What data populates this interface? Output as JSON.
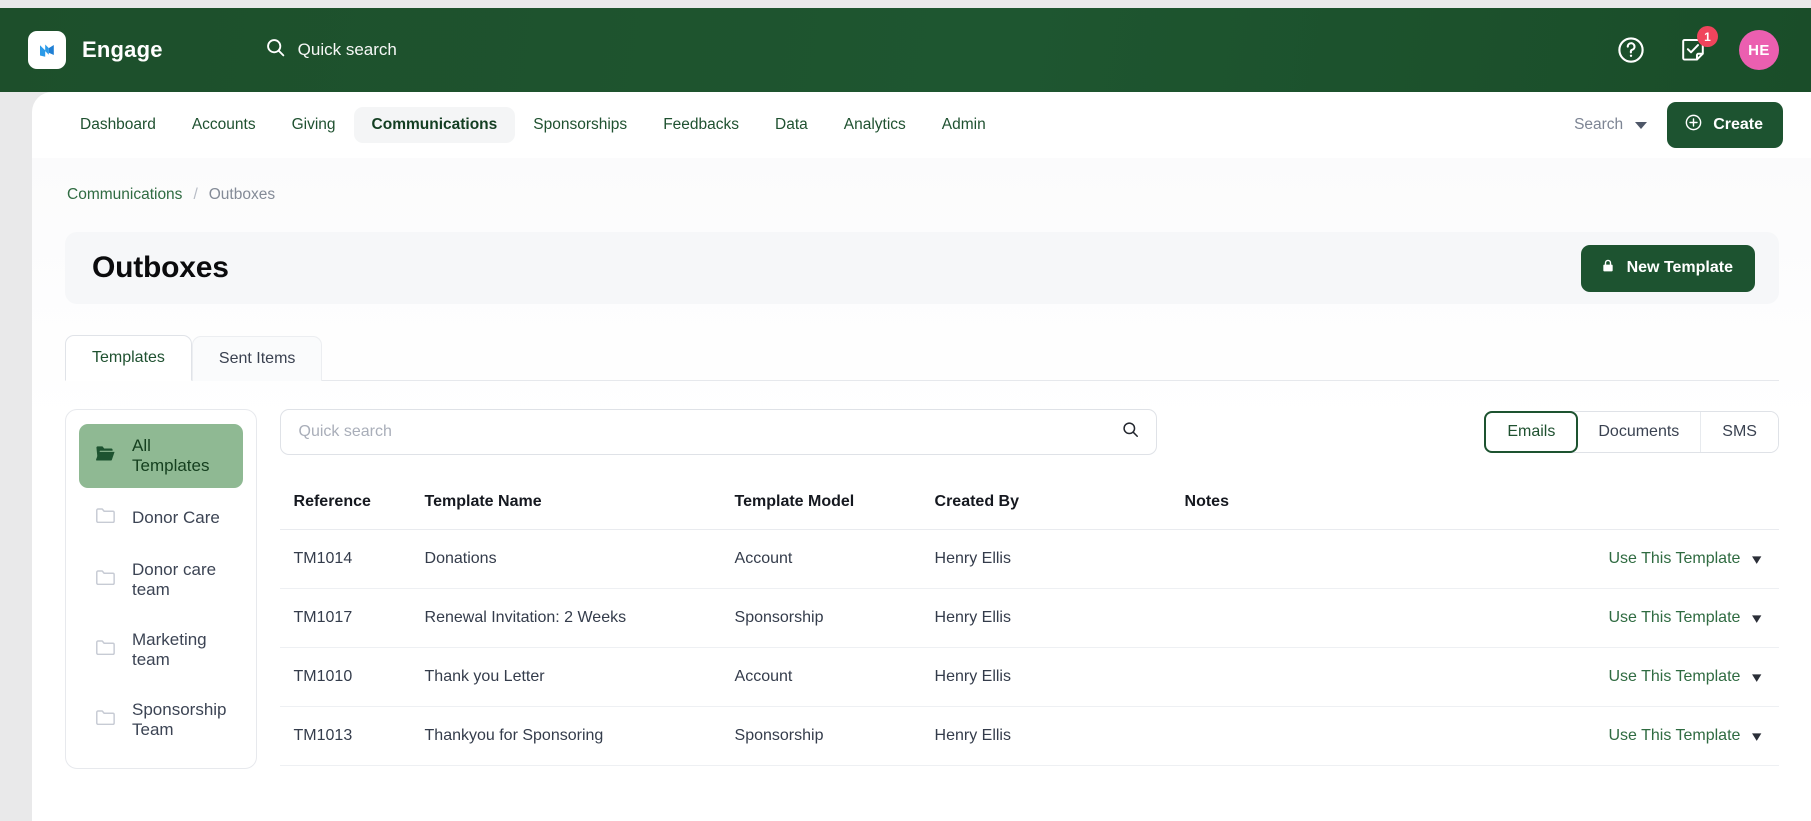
{
  "header": {
    "brand": "Engage",
    "logo_icon": "engage-logo-icon",
    "quick_search_placeholder": "Quick search",
    "search_icon": "search-icon",
    "help_icon": "help-circle-icon",
    "tasks_icon": "task-note-icon",
    "tasks_badge": "1",
    "avatar_initials": "HE",
    "colors": {
      "bar": "#1e5630",
      "badge": "#f0445c",
      "avatar": "#eb5fb0"
    }
  },
  "nav": {
    "items": [
      {
        "label": "Dashboard",
        "active": false
      },
      {
        "label": "Accounts",
        "active": false
      },
      {
        "label": "Giving",
        "active": false
      },
      {
        "label": "Communications",
        "active": true
      },
      {
        "label": "Sponsorships",
        "active": false
      },
      {
        "label": "Feedbacks",
        "active": false
      },
      {
        "label": "Data",
        "active": false
      },
      {
        "label": "Analytics",
        "active": false
      },
      {
        "label": "Admin",
        "active": false
      }
    ],
    "search_label": "Search",
    "create_label": "Create",
    "create_icon": "plus-circle-icon",
    "dropdown_icon": "chevron-down-icon"
  },
  "breadcrumb": {
    "parent": "Communications",
    "separator": "/",
    "current": "Outboxes"
  },
  "page": {
    "title": "Outboxes",
    "new_template_label": "New Template",
    "new_template_icon": "lock-icon"
  },
  "tabs": [
    {
      "label": "Templates",
      "active": true
    },
    {
      "label": "Sent Items",
      "active": false
    }
  ],
  "folders": {
    "items": [
      {
        "label": "All Templates",
        "active": true,
        "icon": "folder-open-icon"
      },
      {
        "label": "Donor Care",
        "active": false,
        "icon": "folder-icon"
      },
      {
        "label": "Donor care team",
        "active": false,
        "icon": "folder-icon"
      },
      {
        "label": "Marketing team",
        "active": false,
        "icon": "folder-icon"
      },
      {
        "label": "Sponsorship Team",
        "active": false,
        "icon": "folder-icon"
      }
    ],
    "active_color": "#8fb993"
  },
  "toolbar": {
    "search_placeholder": "Quick search",
    "search_value": "",
    "search_icon": "search-icon",
    "segments": [
      {
        "label": "Emails",
        "active": true
      },
      {
        "label": "Documents",
        "active": false
      },
      {
        "label": "SMS",
        "active": false
      }
    ]
  },
  "table": {
    "columns": [
      "Reference",
      "Template Name",
      "Template Model",
      "Created By",
      "Notes",
      ""
    ],
    "action_label": "Use This Template",
    "action_icon": "chevron-down-icon",
    "rows": [
      {
        "reference": "TM1014",
        "name": "Donations",
        "model": "Account",
        "created_by": "Henry Ellis",
        "notes": ""
      },
      {
        "reference": "TM1017",
        "name": "Renewal Invitation: 2 Weeks",
        "model": "Sponsorship",
        "created_by": "Henry Ellis",
        "notes": ""
      },
      {
        "reference": "TM1010",
        "name": "Thank you Letter",
        "model": "Account",
        "created_by": "Henry Ellis",
        "notes": ""
      },
      {
        "reference": "TM1013",
        "name": "Thankyou for Sponsoring",
        "model": "Sponsorship",
        "created_by": "Henry Ellis",
        "notes": ""
      }
    ]
  }
}
